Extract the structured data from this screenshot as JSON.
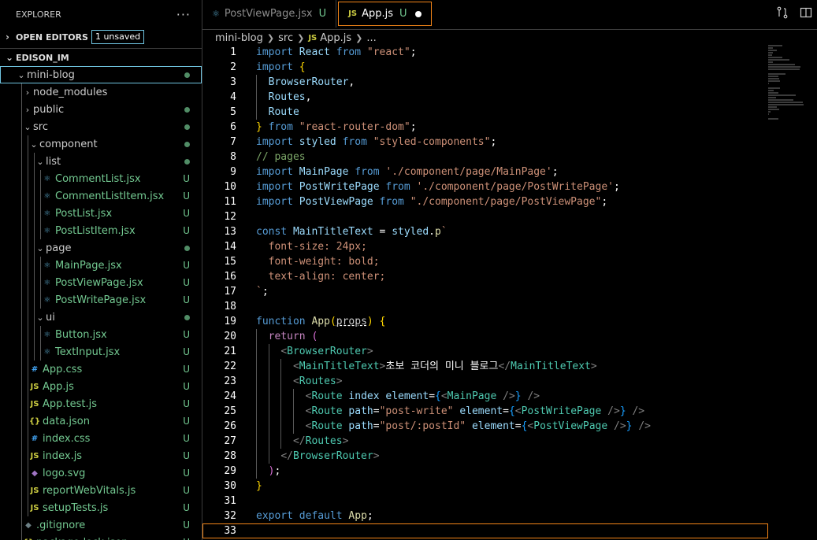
{
  "explorer": {
    "title": "EXPLORER",
    "more": "···",
    "open_editors": {
      "label": "OPEN EDITORS",
      "badge": "1 unsaved"
    },
    "workspace": "EDISON_IM",
    "tree": [
      {
        "label": "mini-blog",
        "type": "folder",
        "open": true,
        "depth": 0,
        "status": "dot",
        "selected": true
      },
      {
        "label": "node_modules",
        "type": "folder",
        "open": false,
        "depth": 1,
        "status": ""
      },
      {
        "label": "public",
        "type": "folder",
        "open": false,
        "depth": 1,
        "status": "dot"
      },
      {
        "label": "src",
        "type": "folder",
        "open": true,
        "depth": 1,
        "status": "dot"
      },
      {
        "label": "component",
        "type": "folder",
        "open": true,
        "depth": 2,
        "status": "dot"
      },
      {
        "label": "list",
        "type": "folder",
        "open": true,
        "depth": 3,
        "status": "dot"
      },
      {
        "label": "CommentList.jsx",
        "type": "jsx",
        "depth": 4,
        "status": "U"
      },
      {
        "label": "CommentListItem.jsx",
        "type": "jsx",
        "depth": 4,
        "status": "U"
      },
      {
        "label": "PostList.jsx",
        "type": "jsx",
        "depth": 4,
        "status": "U"
      },
      {
        "label": "PostListItem.jsx",
        "type": "jsx",
        "depth": 4,
        "status": "U"
      },
      {
        "label": "page",
        "type": "folder",
        "open": true,
        "depth": 3,
        "status": "dot"
      },
      {
        "label": "MainPage.jsx",
        "type": "jsx",
        "depth": 4,
        "status": "U"
      },
      {
        "label": "PostViewPage.jsx",
        "type": "jsx",
        "depth": 4,
        "status": "U"
      },
      {
        "label": "PostWritePage.jsx",
        "type": "jsx",
        "depth": 4,
        "status": "U"
      },
      {
        "label": "ui",
        "type": "folder",
        "open": true,
        "depth": 3,
        "status": "dot"
      },
      {
        "label": "Button.jsx",
        "type": "jsx",
        "depth": 4,
        "status": "U"
      },
      {
        "label": "TextInput.jsx",
        "type": "jsx",
        "depth": 4,
        "status": "U"
      },
      {
        "label": "App.css",
        "type": "css",
        "depth": 2,
        "status": "U"
      },
      {
        "label": "App.js",
        "type": "js",
        "depth": 2,
        "status": "U"
      },
      {
        "label": "App.test.js",
        "type": "js",
        "depth": 2,
        "status": "U"
      },
      {
        "label": "data.json",
        "type": "json",
        "depth": 2,
        "status": "U"
      },
      {
        "label": "index.css",
        "type": "css",
        "depth": 2,
        "status": "U"
      },
      {
        "label": "index.js",
        "type": "js",
        "depth": 2,
        "status": "U"
      },
      {
        "label": "logo.svg",
        "type": "svg",
        "depth": 2,
        "status": "U"
      },
      {
        "label": "reportWebVitals.js",
        "type": "js",
        "depth": 2,
        "status": "U"
      },
      {
        "label": "setupTests.js",
        "type": "js",
        "depth": 2,
        "status": "U"
      },
      {
        "label": ".gitignore",
        "type": "git",
        "depth": 1,
        "status": "U"
      },
      {
        "label": "package-lock.json",
        "type": "json",
        "depth": 1,
        "status": "U"
      }
    ]
  },
  "tabs": [
    {
      "label": "PostViewPage.jsx",
      "status": "U",
      "icon": "react-icon",
      "active": false
    },
    {
      "label": "App.js",
      "status": "U",
      "icon": "js-icon",
      "active": true,
      "unsaved": true
    }
  ],
  "breadcrumb": [
    "mini-blog",
    "src",
    "App.js",
    "..."
  ],
  "breadcrumb_js": "JS",
  "editor": {
    "current_line": 33,
    "lines": [
      [
        [
          "kw",
          "import"
        ],
        [
          "punc",
          " "
        ],
        [
          "id",
          "React"
        ],
        [
          "punc",
          " "
        ],
        [
          "kw",
          "from"
        ],
        [
          "punc",
          " "
        ],
        [
          "str",
          "\"react\""
        ],
        [
          "punc",
          ";"
        ]
      ],
      [
        [
          "kw",
          "import"
        ],
        [
          "punc",
          " "
        ],
        [
          "brk1",
          "{"
        ]
      ],
      [
        [
          "punc",
          "  "
        ],
        [
          "id",
          "BrowserRouter"
        ],
        [
          "punc",
          ","
        ]
      ],
      [
        [
          "punc",
          "  "
        ],
        [
          "id",
          "Routes"
        ],
        [
          "punc",
          ","
        ]
      ],
      [
        [
          "punc",
          "  "
        ],
        [
          "id",
          "Route"
        ]
      ],
      [
        [
          "brk1",
          "}"
        ],
        [
          "punc",
          " "
        ],
        [
          "kw",
          "from"
        ],
        [
          "punc",
          " "
        ],
        [
          "str",
          "\"react-router-dom\""
        ],
        [
          "punc",
          ";"
        ]
      ],
      [
        [
          "kw",
          "import"
        ],
        [
          "punc",
          " "
        ],
        [
          "id",
          "styled"
        ],
        [
          "punc",
          " "
        ],
        [
          "kw",
          "from"
        ],
        [
          "punc",
          " "
        ],
        [
          "str",
          "\"styled-components\""
        ],
        [
          "punc",
          ";"
        ]
      ],
      [
        [
          "cmt",
          "// pages"
        ]
      ],
      [
        [
          "kw",
          "import"
        ],
        [
          "punc",
          " "
        ],
        [
          "id",
          "MainPage"
        ],
        [
          "punc",
          " "
        ],
        [
          "kw",
          "from"
        ],
        [
          "punc",
          " "
        ],
        [
          "str",
          "'./component/page/MainPage'"
        ],
        [
          "punc",
          ";"
        ]
      ],
      [
        [
          "kw",
          "import"
        ],
        [
          "punc",
          " "
        ],
        [
          "id",
          "PostWritePage"
        ],
        [
          "punc",
          " "
        ],
        [
          "kw",
          "from"
        ],
        [
          "punc",
          " "
        ],
        [
          "str",
          "'./component/page/PostWritePage'"
        ],
        [
          "punc",
          ";"
        ]
      ],
      [
        [
          "kw",
          "import"
        ],
        [
          "punc",
          " "
        ],
        [
          "id",
          "PostViewPage"
        ],
        [
          "punc",
          " "
        ],
        [
          "kw",
          "from"
        ],
        [
          "punc",
          " "
        ],
        [
          "str",
          "\"./component/page/PostViewPage\""
        ],
        [
          "punc",
          ";"
        ]
      ],
      [],
      [
        [
          "kw",
          "const"
        ],
        [
          "punc",
          " "
        ],
        [
          "id",
          "MainTitleText"
        ],
        [
          "punc",
          " = "
        ],
        [
          "id",
          "styled"
        ],
        [
          "punc",
          "."
        ],
        [
          "fn",
          "p"
        ],
        [
          "str",
          "`"
        ]
      ],
      [
        [
          "str",
          "  font-size: 24px;"
        ]
      ],
      [
        [
          "str",
          "  font-weight: bold;"
        ]
      ],
      [
        [
          "str",
          "  text-align: center;"
        ]
      ],
      [
        [
          "str",
          "`"
        ],
        [
          "punc",
          ";"
        ]
      ],
      [],
      [
        [
          "kw",
          "function"
        ],
        [
          "punc",
          " "
        ],
        [
          "fn",
          "App"
        ],
        [
          "brk1",
          "("
        ],
        [
          "squig",
          "props"
        ],
        [
          "brk1",
          ")"
        ],
        [
          "punc",
          " "
        ],
        [
          "brk1",
          "{"
        ]
      ],
      [
        [
          "punc",
          "  "
        ],
        [
          "ctrl",
          "return"
        ],
        [
          "punc",
          " "
        ],
        [
          "brk2",
          "("
        ]
      ],
      [
        [
          "punc",
          "    "
        ],
        [
          "tagp",
          "<"
        ],
        [
          "comp",
          "BrowserRouter"
        ],
        [
          "tagp",
          ">"
        ]
      ],
      [
        [
          "punc",
          "      "
        ],
        [
          "tagp",
          "<"
        ],
        [
          "comp",
          "MainTitleText"
        ],
        [
          "tagp",
          ">"
        ],
        [
          "txt",
          "초보 코더의 미니 블로그"
        ],
        [
          "tagp",
          "</"
        ],
        [
          "comp",
          "MainTitleText"
        ],
        [
          "tagp",
          ">"
        ]
      ],
      [
        [
          "punc",
          "      "
        ],
        [
          "tagp",
          "<"
        ],
        [
          "comp",
          "Routes"
        ],
        [
          "tagp",
          ">"
        ]
      ],
      [
        [
          "punc",
          "        "
        ],
        [
          "tagp",
          "<"
        ],
        [
          "comp",
          "Route"
        ],
        [
          "punc",
          " "
        ],
        [
          "attr",
          "index"
        ],
        [
          "punc",
          " "
        ],
        [
          "attr",
          "element"
        ],
        [
          "punc",
          "="
        ],
        [
          "brk3",
          "{"
        ],
        [
          "tagp",
          "<"
        ],
        [
          "comp",
          "MainPage"
        ],
        [
          "punc",
          " "
        ],
        [
          "tagp",
          "/>"
        ],
        [
          "brk3",
          "}"
        ],
        [
          "punc",
          " "
        ],
        [
          "tagp",
          "/>"
        ]
      ],
      [
        [
          "punc",
          "        "
        ],
        [
          "tagp",
          "<"
        ],
        [
          "comp",
          "Route"
        ],
        [
          "punc",
          " "
        ],
        [
          "attr",
          "path"
        ],
        [
          "punc",
          "="
        ],
        [
          "str",
          "\"post-write\""
        ],
        [
          "punc",
          " "
        ],
        [
          "attr",
          "element"
        ],
        [
          "punc",
          "="
        ],
        [
          "brk3",
          "{"
        ],
        [
          "tagp",
          "<"
        ],
        [
          "comp",
          "PostWritePage"
        ],
        [
          "punc",
          " "
        ],
        [
          "tagp",
          "/>"
        ],
        [
          "brk3",
          "}"
        ],
        [
          "punc",
          " "
        ],
        [
          "tagp",
          "/>"
        ]
      ],
      [
        [
          "punc",
          "        "
        ],
        [
          "tagp",
          "<"
        ],
        [
          "comp",
          "Route"
        ],
        [
          "punc",
          " "
        ],
        [
          "attr",
          "path"
        ],
        [
          "punc",
          "="
        ],
        [
          "str",
          "\"post/:postId\""
        ],
        [
          "punc",
          " "
        ],
        [
          "attr",
          "element"
        ],
        [
          "punc",
          "="
        ],
        [
          "brk3",
          "{"
        ],
        [
          "tagp",
          "<"
        ],
        [
          "comp",
          "PostViewPage"
        ],
        [
          "punc",
          " "
        ],
        [
          "tagp",
          "/>"
        ],
        [
          "brk3",
          "}"
        ],
        [
          "punc",
          " "
        ],
        [
          "tagp",
          "/>"
        ]
      ],
      [
        [
          "punc",
          "      "
        ],
        [
          "tagp",
          "</"
        ],
        [
          "comp",
          "Routes"
        ],
        [
          "tagp",
          ">"
        ]
      ],
      [
        [
          "punc",
          "    "
        ],
        [
          "tagp",
          "</"
        ],
        [
          "comp",
          "BrowserRouter"
        ],
        [
          "tagp",
          ">"
        ]
      ],
      [
        [
          "punc",
          "  "
        ],
        [
          "brk2",
          ")"
        ],
        [
          "punc",
          ";"
        ]
      ],
      [
        [
          "brk1",
          "}"
        ]
      ],
      [],
      [
        [
          "kw",
          "export"
        ],
        [
          "punc",
          " "
        ],
        [
          "kw",
          "default"
        ],
        [
          "punc",
          " "
        ],
        [
          "fn",
          "App"
        ],
        [
          "punc",
          ";"
        ]
      ],
      []
    ]
  },
  "colors": {
    "accent_focus": "#f38518",
    "selection_outline": "#6fc3df",
    "git_untracked": "#73c991",
    "js_icon": "#cbcb41",
    "react_icon": "#519aba"
  }
}
